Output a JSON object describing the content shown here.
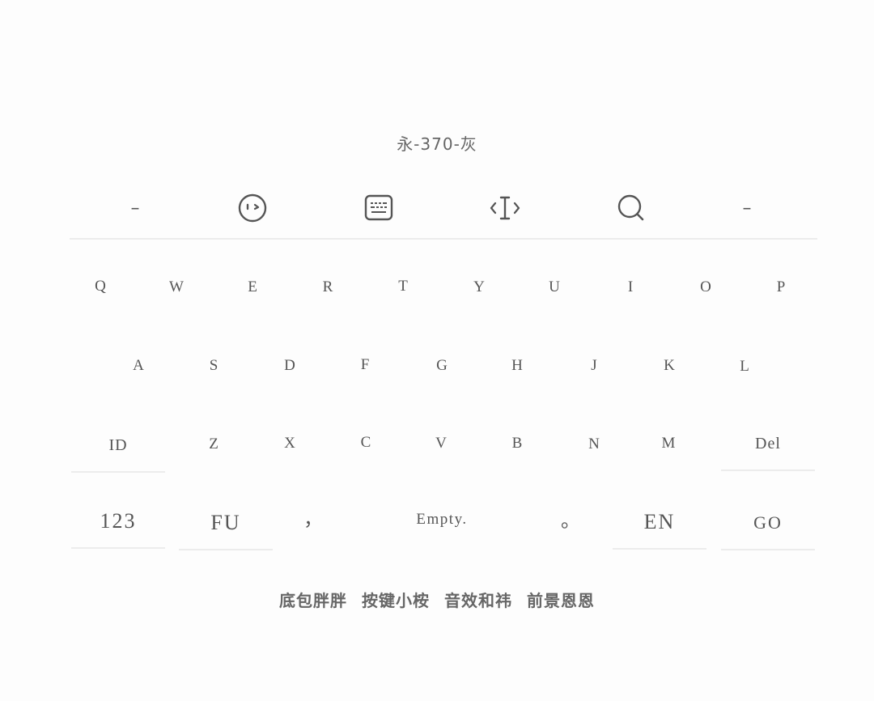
{
  "header": {
    "title": "永-370-灰"
  },
  "toolbar": {
    "left_dash": "–",
    "right_dash": "–",
    "icons": [
      "emoji-face-icon",
      "keyboard-icon",
      "text-cursor-icon",
      "search-icon"
    ]
  },
  "keyboard": {
    "row1": [
      "Q",
      "W",
      "E",
      "R",
      "T",
      "Y",
      "U",
      "I",
      "O",
      "P"
    ],
    "row2": [
      "A",
      "S",
      "D",
      "F",
      "G",
      "H",
      "J",
      "K",
      "L"
    ],
    "row3": {
      "left": "ID",
      "letters": [
        "Z",
        "X",
        "C",
        "V",
        "B",
        "N",
        "M"
      ],
      "right": "Del"
    },
    "row4": {
      "num": "123",
      "fu": "FU",
      "comma": "，",
      "space": "Empty.",
      "period": "。",
      "lang": "EN",
      "go": "GO"
    }
  },
  "footer": {
    "items": [
      "底包胖胖",
      "按键小桉",
      "音效和祎",
      "前景恩恩"
    ]
  }
}
